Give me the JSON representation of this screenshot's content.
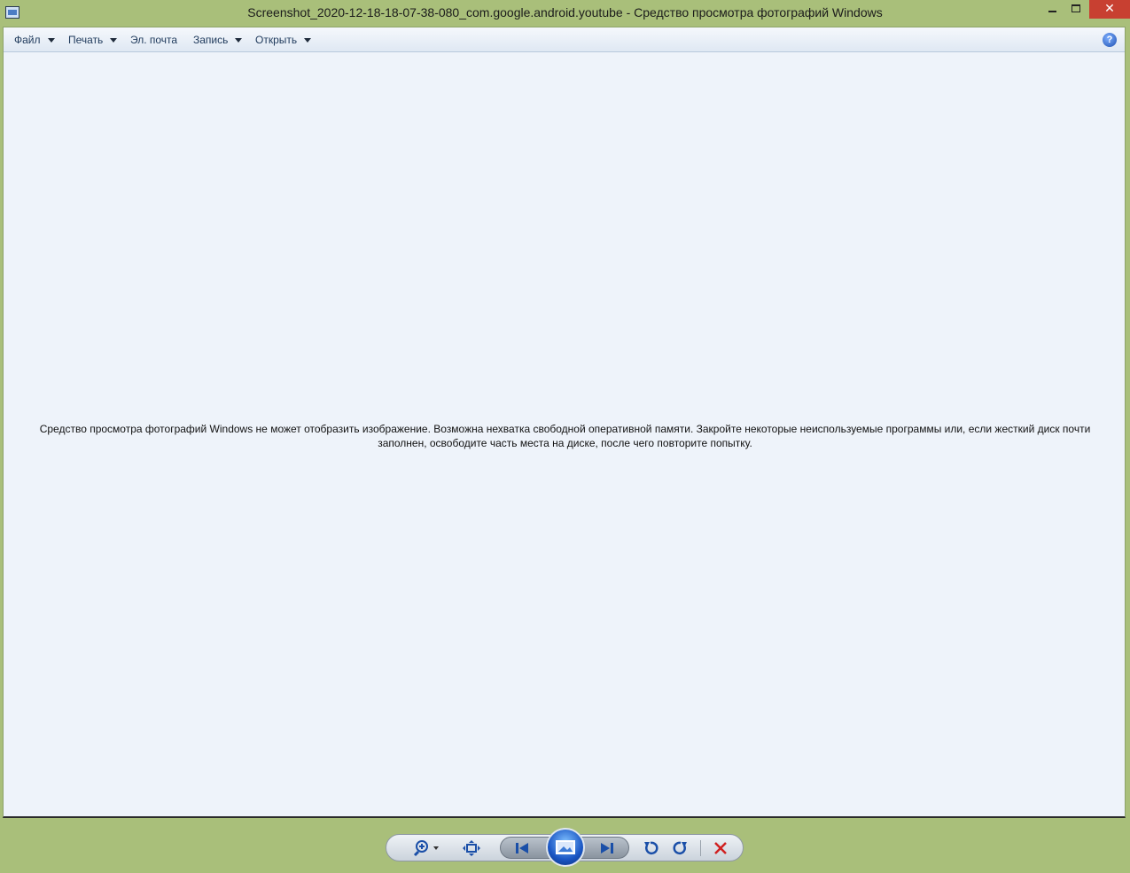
{
  "window": {
    "title": "Screenshot_2020-12-18-18-07-38-080_com.google.android.youtube - Средство просмотра фотографий Windows",
    "close_glyph": "✕"
  },
  "menubar": {
    "items": [
      {
        "label": "Файл",
        "dropdown": true
      },
      {
        "label": "Печать",
        "dropdown": true
      },
      {
        "label": "Эл. почта",
        "dropdown": false
      },
      {
        "label": "Запись",
        "dropdown": true
      },
      {
        "label": "Открыть",
        "dropdown": true
      }
    ],
    "help_glyph": "?"
  },
  "viewer": {
    "message": "Средство просмотра фотографий Windows не может отобразить изображение. Возможна нехватка свободной оперативной памяти. Закройте некоторые неиспользуемые программы или, если жесткий диск почти заполнен, освободите часть места на диске, после чего повторите попытку."
  },
  "toolbar": {
    "buttons": [
      "zoom-icon",
      "fit-to-window-icon",
      "previous-icon",
      "slideshow-icon",
      "next-icon",
      "rotate-counterclockwise-icon",
      "rotate-clockwise-icon",
      "delete-icon"
    ]
  },
  "colors": {
    "frame": "#a9bf7a",
    "viewer_bg": "#eef3fa",
    "close_button": "#c84031",
    "accent_blue": "#1a56c4",
    "delete_red": "#d02020"
  }
}
